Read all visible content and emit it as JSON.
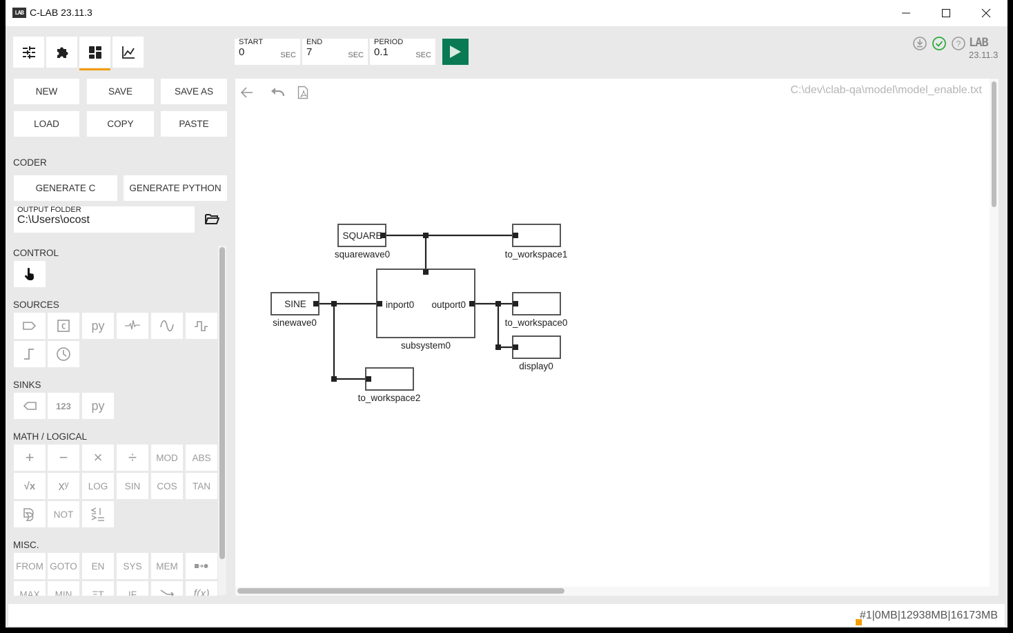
{
  "window": {
    "title": "C-LAB 23.11.3",
    "logo_text": "LAB",
    "controls": [
      "minimize",
      "maximize",
      "close"
    ]
  },
  "top_tabs": [
    {
      "name": "settings",
      "icon": "sliders-icon",
      "active": false
    },
    {
      "name": "plugins",
      "icon": "puzzle-icon",
      "active": false
    },
    {
      "name": "blocks",
      "icon": "dashboard-icon",
      "active": true
    },
    {
      "name": "plots",
      "icon": "chart-line-icon",
      "active": false
    }
  ],
  "simulation": {
    "start": {
      "label": "START",
      "value": "0",
      "unit": "SEC"
    },
    "end": {
      "label": "END",
      "value": "7",
      "unit": "SEC"
    },
    "period": {
      "label": "PERIOD",
      "value": "0.1",
      "unit": "SEC"
    },
    "run_icon": "play-icon",
    "run_color": "#0a7a54"
  },
  "header_right": {
    "icons": [
      "download-icon",
      "check-circle-icon",
      "help-icon"
    ],
    "brand": "LAB",
    "version": "23.11.3",
    "check_color": "#2eaa3c"
  },
  "file_actions": {
    "new": "NEW",
    "save": "SAVE",
    "save_as": "SAVE AS",
    "load": "LOAD",
    "copy": "COPY",
    "paste": "PASTE"
  },
  "coder": {
    "section": "CODER",
    "generate_c": "GENERATE C",
    "generate_python": "GENERATE PYTHON",
    "output_folder_label": "OUTPUT FOLDER",
    "output_folder_value": "C:\\Users\\ocost"
  },
  "palette": {
    "control": {
      "label": "CONTROL",
      "items": [
        "pointer-hand-icon"
      ]
    },
    "sources": {
      "label": "SOURCES",
      "items": [
        "tag-in-icon",
        "c-code-icon",
        "py",
        "noise-icon",
        "sine-icon",
        "square-wave-icon",
        "step-icon",
        "clock-icon"
      ]
    },
    "sinks": {
      "label": "SINKS",
      "items": [
        "tag-out-icon",
        "123",
        "py"
      ]
    },
    "math": {
      "label": "MATH / LOGICAL",
      "items": [
        "+",
        "−",
        "×",
        "÷",
        "MOD",
        "ABS",
        "√x",
        "xʸ",
        "LOG",
        "SIN",
        "COS",
        "TAN",
        "logic-gate-icon",
        "NOT",
        "compare-icon"
      ]
    },
    "misc": {
      "label": "MISC.",
      "items": [
        "FROM",
        "GOTO",
        "EN",
        "SYS",
        "MEM",
        "signal-flow-icon",
        "MAX",
        "MIN",
        "ΞT",
        "IF",
        "switch-icon",
        "f(x)"
      ]
    }
  },
  "canvas": {
    "tools": [
      "back-arrow-icon",
      "undo-icon",
      "pdf-icon"
    ],
    "file_path": "C:\\dev\\clab-qa\\model\\model_enable.txt",
    "blocks": [
      {
        "id": "squarewave0",
        "label": "SQUARE",
        "name": "squarewave0"
      },
      {
        "id": "to_workspace1",
        "label": "",
        "name": "to_workspace1"
      },
      {
        "id": "sinewave0",
        "label": "SINE",
        "name": "sinewave0"
      },
      {
        "id": "subsystem0",
        "label": "",
        "name": "subsystem0",
        "inport": "inport0",
        "outport": "outport0"
      },
      {
        "id": "to_workspace0",
        "label": "",
        "name": "to_workspace0"
      },
      {
        "id": "display0",
        "label": "",
        "name": "display0"
      },
      {
        "id": "to_workspace2",
        "label": "",
        "name": "to_workspace2"
      }
    ],
    "connections": [
      [
        "squarewave0",
        "to_workspace1"
      ],
      [
        "squarewave0",
        "subsystem0.enable"
      ],
      [
        "sinewave0",
        "subsystem0.inport0"
      ],
      [
        "sinewave0",
        "to_workspace2"
      ],
      [
        "subsystem0.outport0",
        "to_workspace0"
      ],
      [
        "subsystem0.outport0",
        "display0"
      ]
    ]
  },
  "statusbar": {
    "text": "#1|0MB|12938MB|16173MB",
    "indicator_color": "#f59d00"
  }
}
